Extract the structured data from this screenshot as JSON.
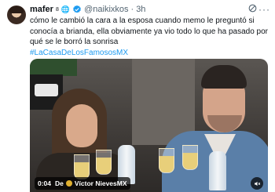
{
  "author": {
    "name": "mafer",
    "superscript": "8",
    "emoji": "🌐",
    "handle": "@naikixkos",
    "separator": "·",
    "time": "3h"
  },
  "tweet": {
    "text": "cómo le cambió la cara a la esposa cuando memo le preguntó si conocía a brianda, ella obviamente ya vio todo lo que ha pasado por qué se le borró la sonrisa",
    "hashtag": "#LaCasaDeLosFamososMX"
  },
  "media": {
    "duration": "0:04",
    "credit_prefix": "De",
    "credit_source": "Víctor NievesMX"
  },
  "colors": {
    "accent": "#1d9bf0",
    "secondary_text": "#536471"
  },
  "icons": [
    "avatar",
    "verified-icon",
    "grok-icon",
    "more-icon",
    "channel-icon",
    "mute-icon"
  ]
}
